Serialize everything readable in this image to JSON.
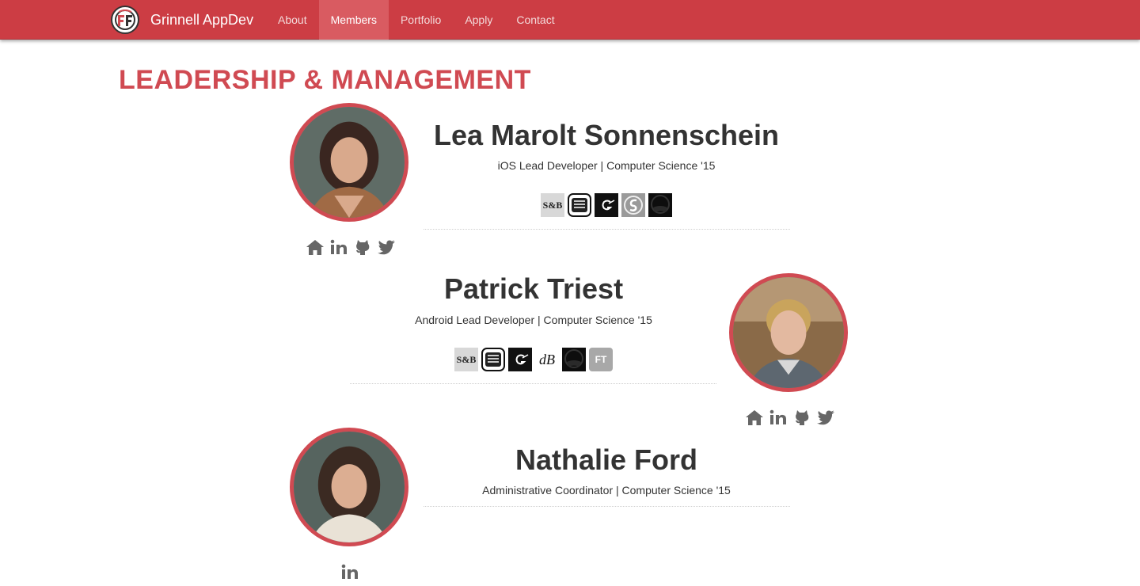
{
  "navbar": {
    "brand": "Grinnell AppDev",
    "items": [
      {
        "label": "About"
      },
      {
        "label": "Members"
      },
      {
        "label": "Portfolio"
      },
      {
        "label": "Apply"
      },
      {
        "label": "Contact"
      }
    ],
    "active_item": "Members"
  },
  "section": {
    "title": "LEADERSHIP & MANAGEMENT"
  },
  "members": [
    {
      "name": "Lea Marolt Sonnenschein",
      "role": "iOS Lead Developer | Computer Science '15",
      "apps": [
        "app-sb-icon",
        "app-menu-icon",
        "app-g-icon",
        "app-s-icon",
        "app-dark-icon"
      ],
      "socials": [
        "home-icon",
        "linkedin-icon",
        "github-icon",
        "twitter-icon"
      ]
    },
    {
      "name": "Patrick Triest",
      "role": "Android Lead Developer | Computer Science '15",
      "apps": [
        "app-sb-icon",
        "app-menu-icon",
        "app-g-icon",
        "app-db-icon",
        "app-dark-icon",
        "app-ft-icon"
      ],
      "socials": [
        "home-icon",
        "linkedin-icon",
        "github-icon",
        "twitter-icon"
      ]
    },
    {
      "name": "Nathalie Ford",
      "role": "Administrative Coordinator | Computer Science '15",
      "apps": [],
      "socials": [
        "linkedin-icon"
      ]
    }
  ],
  "app_labels": {
    "sb": "S&B",
    "db": "dB",
    "ft": "FT"
  },
  "colors": {
    "navbar": "#cc3d44",
    "nav_active": "#d95b61",
    "accent": "#d04a52",
    "text": "#333333",
    "icon_gray": "#666666"
  }
}
